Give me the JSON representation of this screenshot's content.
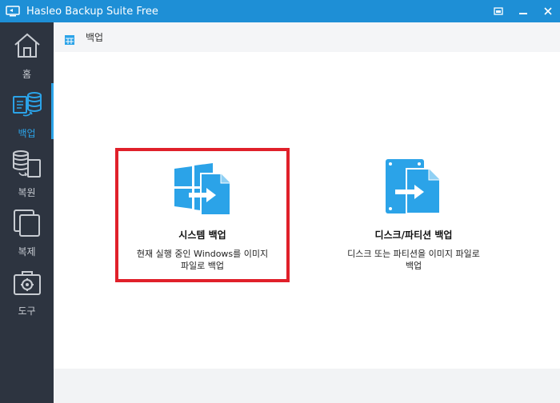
{
  "window": {
    "title": "Hasleo Backup Suite Free"
  },
  "sidebar": {
    "items": [
      {
        "label": "홈",
        "icon": "home-icon",
        "active": false
      },
      {
        "label": "백업",
        "icon": "backup-icon",
        "active": true
      },
      {
        "label": "복원",
        "icon": "restore-icon",
        "active": false
      },
      {
        "label": "복제",
        "icon": "clone-icon",
        "active": false
      },
      {
        "label": "도구",
        "icon": "tools-icon",
        "active": false
      }
    ]
  },
  "header": {
    "title": "백업",
    "icon": "grid-icon"
  },
  "cards": [
    {
      "title": "시스템 백업",
      "description": "현재 실행 중인 Windows를 이미지 파일로 백업",
      "icon": "windows-backup-icon",
      "highlighted": true
    },
    {
      "title": "디스크/파티션 백업",
      "description": "디스크 또는 파티션을 이미지 파일로 백업",
      "icon": "disk-backup-icon",
      "highlighted": false
    }
  ],
  "colors": {
    "titlebar": "#1e8fd6",
    "sidebar": "#2d3440",
    "accent": "#2ba3e8",
    "highlight_border": "#e0202a"
  }
}
